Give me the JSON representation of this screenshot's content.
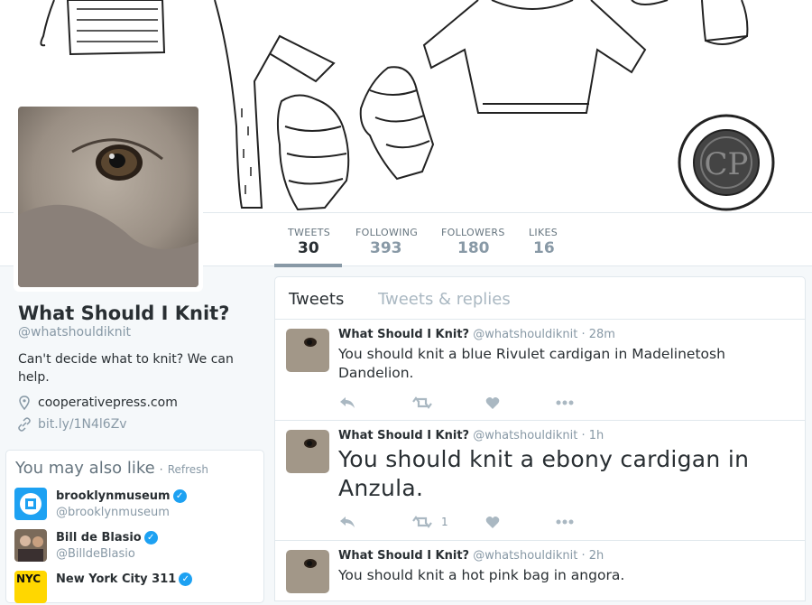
{
  "banner": {
    "logo_text": "CP"
  },
  "stats": [
    {
      "label": "TWEETS",
      "value": "30"
    },
    {
      "label": "FOLLOWING",
      "value": "393"
    },
    {
      "label": "FOLLOWERS",
      "value": "180"
    },
    {
      "label": "LIKES",
      "value": "16"
    }
  ],
  "profile": {
    "name": "What Should I Knit?",
    "handle": "@whatshouldiknit",
    "bio": "Can't decide what to knit? We can help.",
    "location": "cooperativepress.com",
    "url": "bit.ly/1N4l6Zv"
  },
  "who_to_follow": {
    "title": "You may also like",
    "separator": "·",
    "refresh": "Refresh",
    "items": [
      {
        "name": "brooklynmuseum",
        "handle": "@brooklynmuseum"
      },
      {
        "name": "Bill de Blasio",
        "handle": "@BilldeBlasio"
      },
      {
        "name": "New York City 311",
        "handle": "",
        "avatar_text": "NYC"
      }
    ]
  },
  "timeline": {
    "tabs": [
      "Tweets",
      "Tweets & replies"
    ],
    "tweets": [
      {
        "name": "What Should I Knit?",
        "handle": "@whatshouldiknit",
        "time": "· 28m",
        "text": "You should knit a blue Rivulet cardigan in Madelinetosh Dandelion.",
        "retweets": "",
        "likes": ""
      },
      {
        "name": "What Should I Knit?",
        "handle": "@whatshouldiknit",
        "time": "· 1h",
        "text": "You should knit a ebony cardigan in Anzula.",
        "retweets": "1",
        "likes": ""
      },
      {
        "name": "What Should I Knit?",
        "handle": "@whatshouldiknit",
        "time": "· 2h",
        "text": "You should knit a hot pink bag in angora.",
        "retweets": "",
        "likes": ""
      }
    ]
  },
  "colors": {
    "link": "#8899a6",
    "verified": "#1da1f2",
    "text": "#292f33",
    "muted": "#8899a6"
  }
}
